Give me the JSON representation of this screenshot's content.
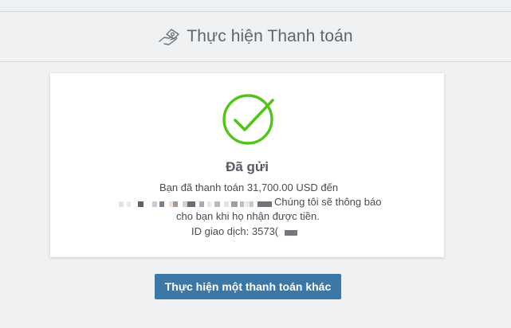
{
  "header": {
    "title": "Thực hiện Thanh toán",
    "icon": "hand-money-icon"
  },
  "result": {
    "status": "Đã gửi",
    "icon": "checkmark-circle-icon",
    "success_color": "#52c41a",
    "message_line1": "Bạn đã thanh toán 31,700.00 USD đến",
    "message_line2": "Chúng tôi sẽ thông báo",
    "message_line3": "cho bạn khi họ nhận được tiền.",
    "transaction_id": "ID giao dịch: 3573("
  },
  "actions": {
    "new_payment_label": "Thực hiện một thanh toán khác",
    "button_color": "#3c78a6"
  }
}
